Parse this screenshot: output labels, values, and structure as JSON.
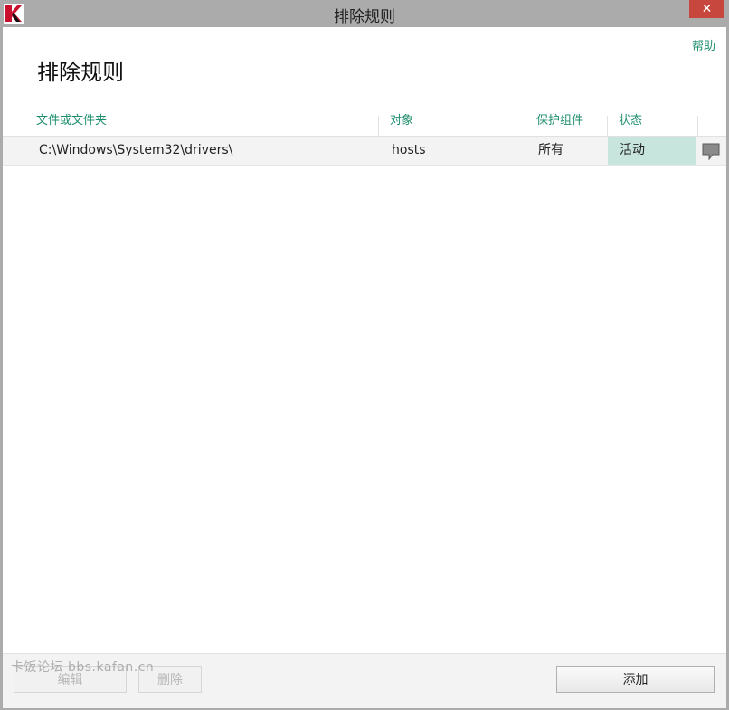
{
  "window": {
    "title": "排除规则",
    "close_label": "✕"
  },
  "header": {
    "help_label": "帮助",
    "page_title": "排除规则"
  },
  "table": {
    "columns": [
      "文件或文件夹",
      "对象",
      "保护组件",
      "状态"
    ],
    "rows": [
      {
        "path": "C:\\Windows\\System32\\drivers\\",
        "object": "hosts",
        "component": "所有",
        "status": "活动"
      }
    ]
  },
  "footer": {
    "edit_label": "编辑",
    "delete_label": "删除",
    "add_label": "添加"
  },
  "watermark": "卡饭论坛 bbs.kafan.cn",
  "colors": {
    "accent": "#1e8d6e",
    "status_bg": "#c7e4dd",
    "close": "#c7463d",
    "logo": "#c8102e"
  }
}
